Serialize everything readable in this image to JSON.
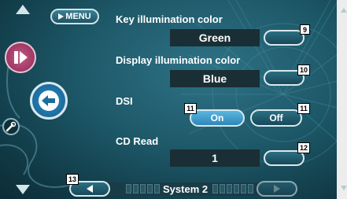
{
  "menu_button": {
    "label": "MENU"
  },
  "settings": {
    "key_illumination": {
      "label": "Key illumination color",
      "value": "Green",
      "callout": "9"
    },
    "display_illumination": {
      "label": "Display illumination color",
      "value": "Blue",
      "callout": "10"
    },
    "dsi": {
      "label": "DSI",
      "on_label": "On",
      "off_label": "Off",
      "selected": "On",
      "on_callout": "11",
      "off_callout": "11"
    },
    "cd_read": {
      "label": "CD Read",
      "value": "1",
      "callout": "12"
    }
  },
  "footer": {
    "page_title": "System 2",
    "prev_callout": "13"
  },
  "colors": {
    "accent_on": "#3c9fd0",
    "background": "#1d5868"
  }
}
